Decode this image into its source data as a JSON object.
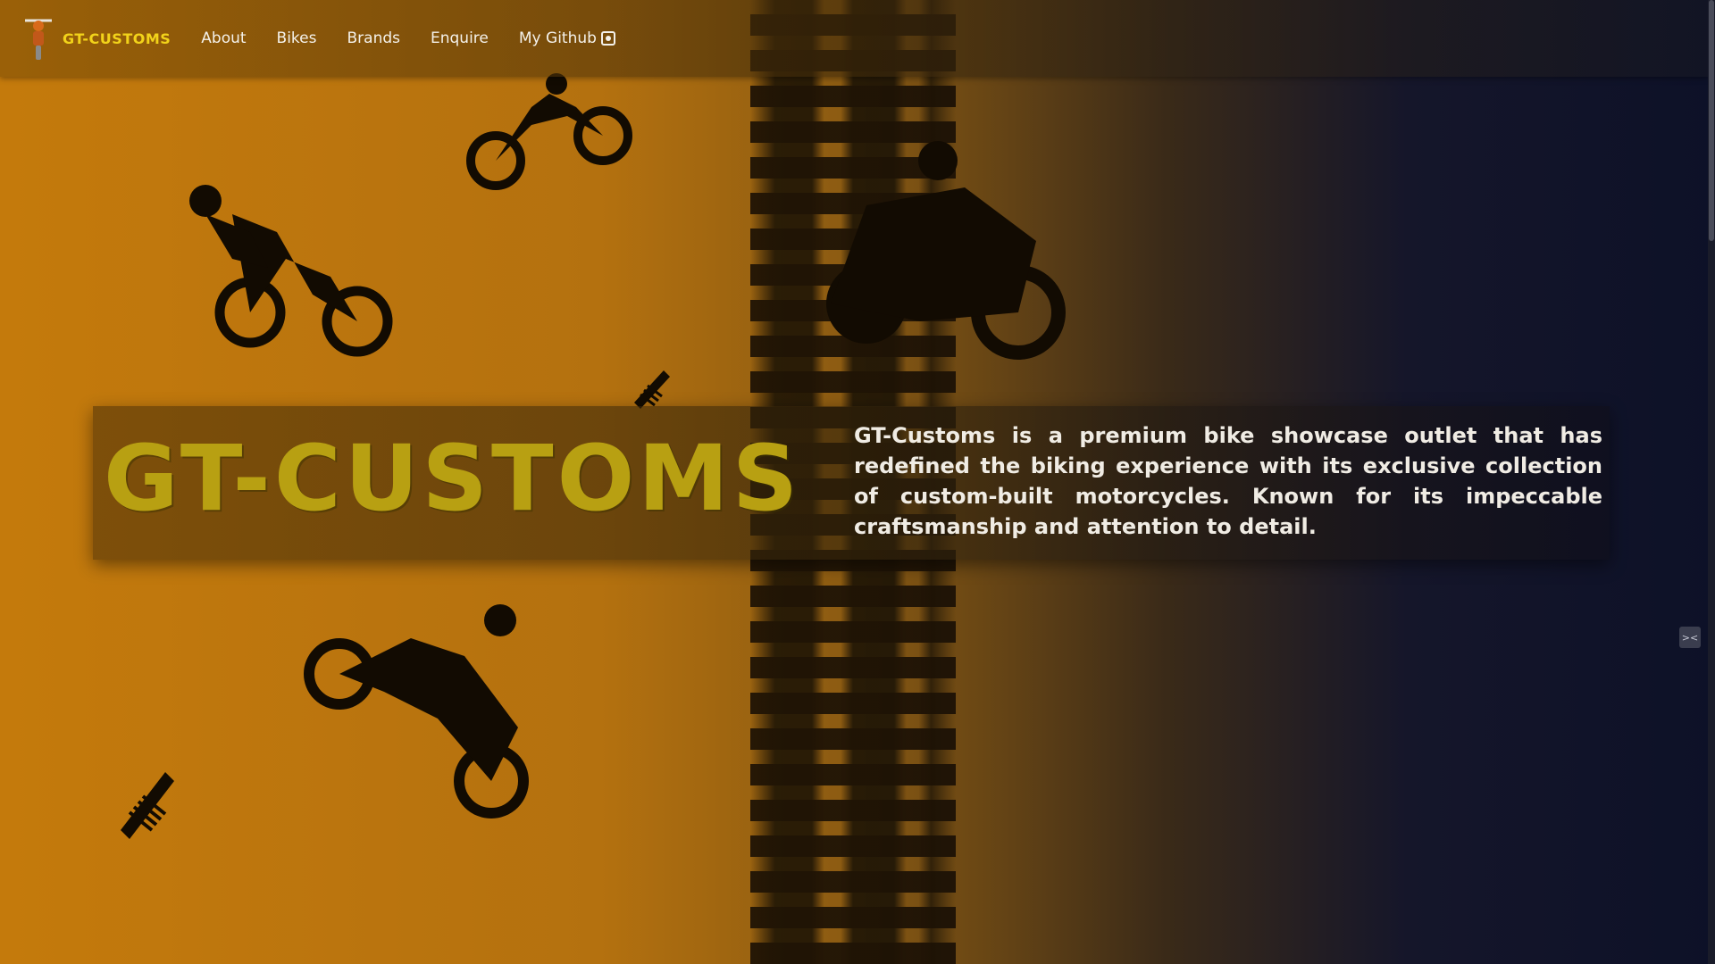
{
  "nav": {
    "brand": "GT-CUSTOMS",
    "links": [
      {
        "label": "About"
      },
      {
        "label": "Bikes"
      },
      {
        "label": "Brands"
      },
      {
        "label": "Enquire"
      },
      {
        "label": "My Github"
      }
    ],
    "github_icon": "github-icon"
  },
  "hero": {
    "title": "GT-CUSTOMS",
    "description": "GT-Customs is a premium bike showcase outlet that has redefined the biking experience with its exclusive collection of custom-built motorcycles. Known for its impeccable craftsmanship and attention to detail."
  },
  "colors": {
    "accent_yellow": "#f2d31a",
    "title_olive": "#b8a012",
    "bg_orange": "#c47a0c",
    "bg_navy": "#0d1128"
  },
  "side_widget": {
    "label": "><"
  }
}
